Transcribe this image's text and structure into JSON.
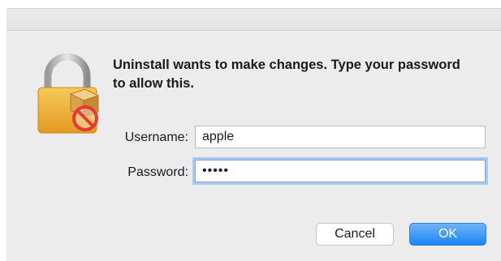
{
  "dialog": {
    "message": "Uninstall wants to make changes. Type your password to allow this.",
    "icon": "lock-with-prohibited-package-icon"
  },
  "form": {
    "username_label": "Username:",
    "username_value": "apple",
    "password_label": "Password:",
    "password_value": "•••••"
  },
  "buttons": {
    "cancel_label": "Cancel",
    "ok_label": "OK"
  },
  "colors": {
    "dialog_background": "#ececec",
    "ok_button": "#1e86f3",
    "focus_ring": "#a9c9f2",
    "lock_gold": "#f0b33a",
    "prohibit_red": "#e53935"
  }
}
